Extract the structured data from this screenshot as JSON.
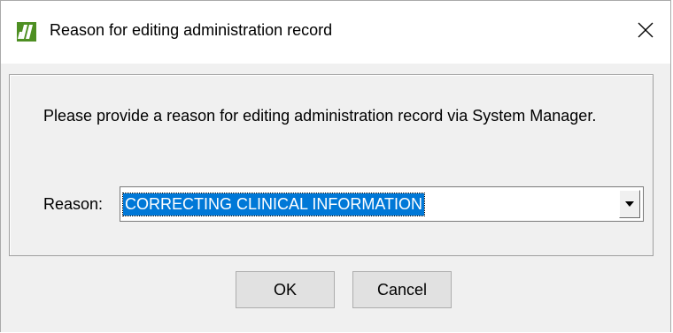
{
  "window": {
    "title": "Reason for editing administration record",
    "app_icon": "app-logo-icon",
    "close_icon": "close-icon"
  },
  "dialog": {
    "prompt": "Please provide a reason for editing administration record via System Manager.",
    "reason_label": "Reason:",
    "reason_value": "CORRECTING CLINICAL INFORMATION",
    "dropdown_icon": "chevron-down-icon"
  },
  "buttons": {
    "ok_label": "OK",
    "cancel_label": "Cancel"
  },
  "colors": {
    "selection": "#0078d7",
    "icon_green": "#5aa02c"
  }
}
